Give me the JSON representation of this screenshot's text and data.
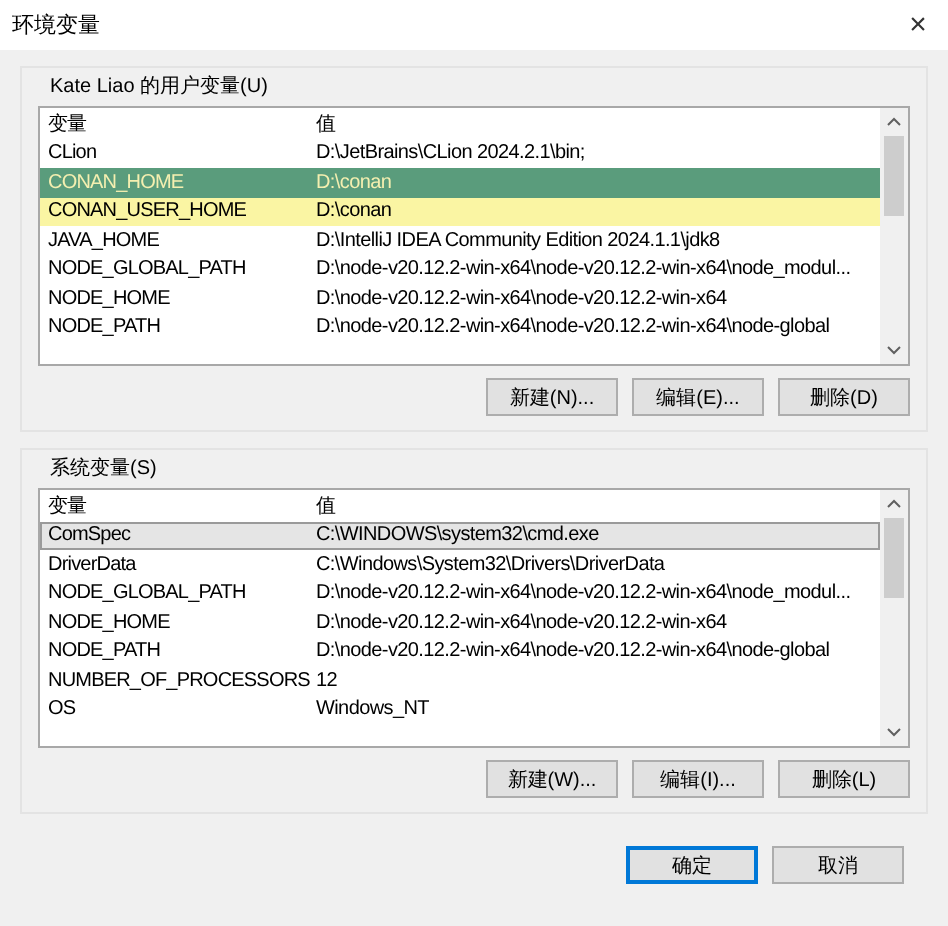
{
  "window": {
    "title": "环境变量",
    "close": "×"
  },
  "user_variables": {
    "label": "Kate Liao 的用户变量(U)",
    "columns": [
      "变量",
      "值"
    ],
    "rows": [
      {
        "name": "CLion",
        "value": "D:\\JetBrains\\CLion 2024.2.1\\bin;",
        "selected": false
      },
      {
        "name": "CONAN_HOME",
        "value": "D:\\conan",
        "selected": false,
        "color": "#5a9c7c"
      },
      {
        "name": "CONAN_USER_HOME",
        "value": "D:\\conan",
        "selected": false,
        "color": "#faf5a3"
      },
      {
        "name": "JAVA_HOME",
        "value": "D:\\IntelliJ IDEA Community Edition 2024.1.1\\jdk8",
        "selected": false
      },
      {
        "name": "NODE_GLOBAL_PATH",
        "value": "D:\\node-v20.12.2-win-x64\\node-v20.12.2-win-x64\\node_modul...",
        "selected": false
      },
      {
        "name": "NODE_HOME",
        "value": "D:\\node-v20.12.2-win-x64\\node-v20.12.2-win-x64",
        "selected": false
      },
      {
        "name": "NODE_PATH",
        "value": "D:\\node-v20.12.2-win-x64\\node-v20.12.2-win-x64\\node-global",
        "selected": false
      }
    ],
    "buttons": [
      "新建(N)...",
      "编辑(E)...",
      "删除(D)"
    ]
  },
  "system_variables": {
    "label": "系统变量(S)",
    "columns": [
      "变量",
      "值"
    ],
    "rows": [
      {
        "name": "ComSpec",
        "value": "C:\\WINDOWS\\system32\\cmd.exe",
        "selected": true
      },
      {
        "name": "DriverData",
        "value": "C:\\Windows\\System32\\Drivers\\DriverData",
        "selected": false
      },
      {
        "name": "NODE_GLOBAL_PATH",
        "value": "D:\\node-v20.12.2-win-x64\\node-v20.12.2-win-x64\\node_modul...",
        "selected": false
      },
      {
        "name": "NODE_HOME",
        "value": "D:\\node-v20.12.2-win-x64\\node-v20.12.2-win-x64",
        "selected": false
      },
      {
        "name": "NODE_PATH",
        "value": "D:\\node-v20.12.2-win-x64\\node-v20.12.2-win-x64\\node-global",
        "selected": false
      },
      {
        "name": "NUMBER_OF_PROCESSORS",
        "value": "12",
        "selected": false
      },
      {
        "name": "OS",
        "value": "Windows_NT",
        "selected": false
      }
    ],
    "buttons": [
      "新建(W)...",
      "编辑(I)...",
      "删除(L)"
    ]
  },
  "dialog_buttons": [
    {
      "label": "确定",
      "default": true
    },
    {
      "label": "取消",
      "default": false
    }
  ]
}
